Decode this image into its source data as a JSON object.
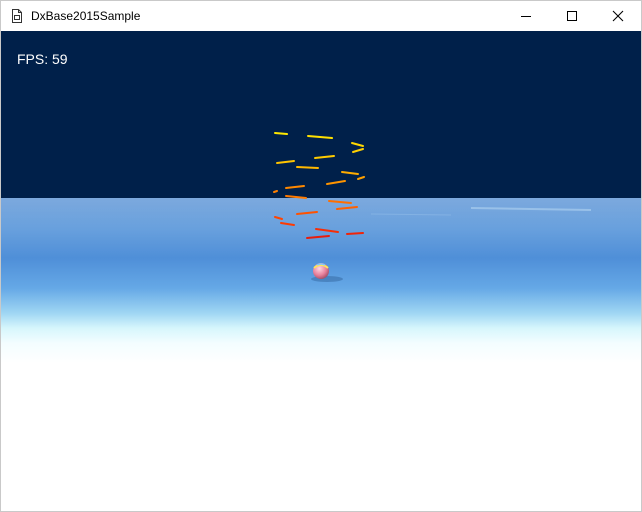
{
  "window": {
    "title": "DxBase2015Sample",
    "icons": {
      "app": "document-app-icon",
      "minimize": "minimize-icon",
      "maximize": "maximize-icon",
      "close": "close-icon"
    }
  },
  "viewport": {
    "fps_text": "FPS: 59",
    "colors": {
      "sky": "#00204a",
      "floor": "#4f8fd8",
      "particle_top": "#ffe600",
      "particle_bottom": "#e81c0c"
    }
  }
}
